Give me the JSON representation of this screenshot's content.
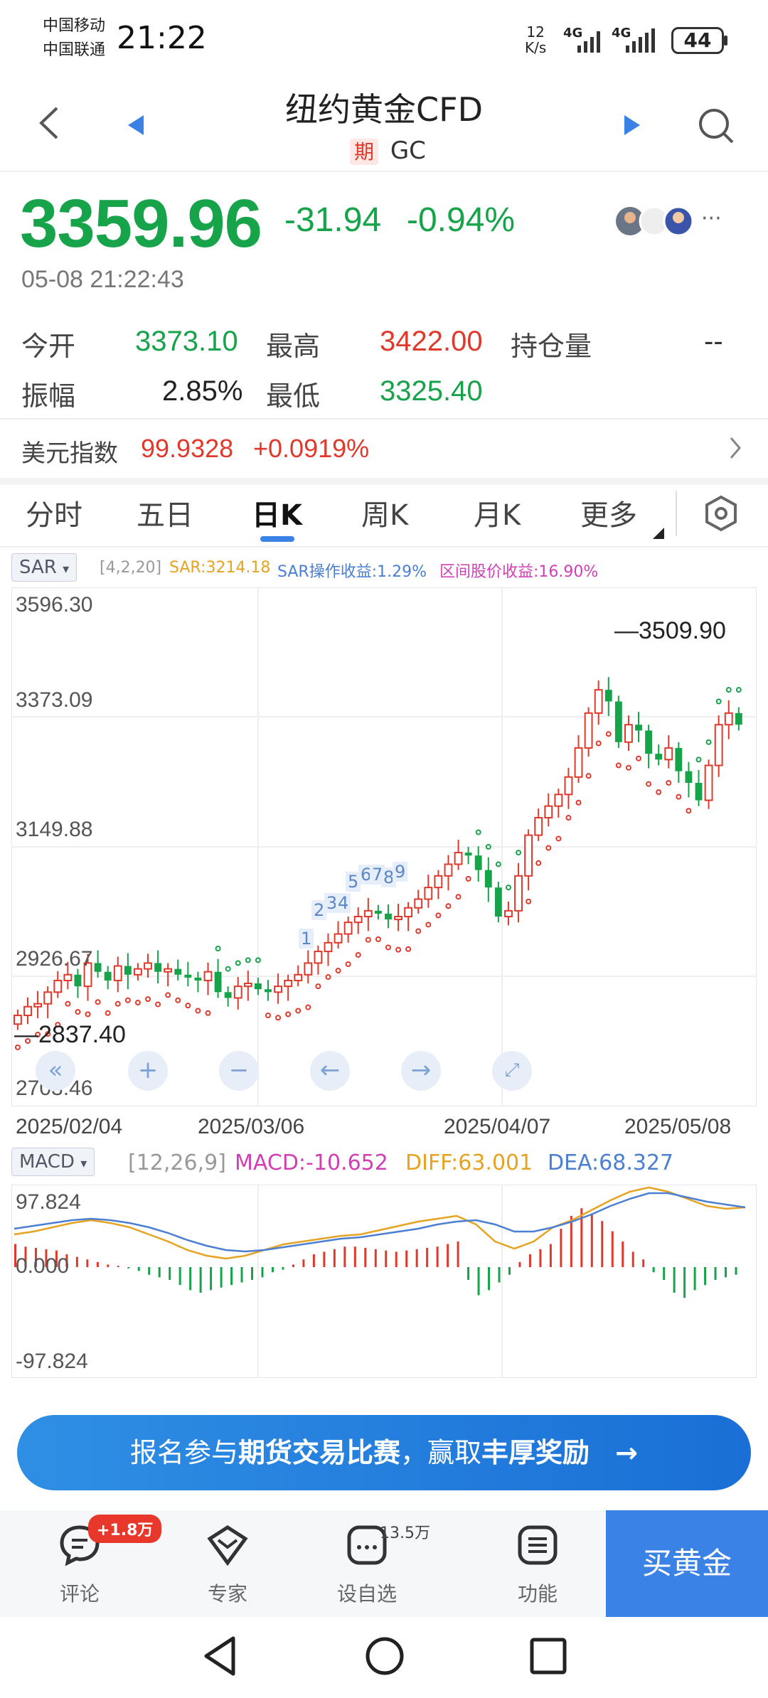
{
  "status": {
    "carrier1": "中国移动",
    "carrier2": "中国联通",
    "time": "21:22",
    "net_speed_value": "12",
    "net_speed_unit": "K/s",
    "sig1": "4G",
    "sig2": "4G",
    "battery": "44"
  },
  "header": {
    "title": "纽约黄金CFD",
    "badge": "期",
    "code": "GC"
  },
  "quote": {
    "price": "3359.96",
    "change": "-31.94",
    "change_pct": "-0.94%",
    "datetime": "05-08 21:22:43",
    "more": "···"
  },
  "stats": {
    "open_label": "今开",
    "open": "3373.10",
    "high_label": "最高",
    "high": "3422.00",
    "oi_label": "持仓量",
    "oi": "--",
    "amp_label": "振幅",
    "amp": "2.85%",
    "low_label": "最低",
    "low": "3325.40"
  },
  "usd": {
    "label": "美元指数",
    "value": "99.9328",
    "change": "+0.0919%"
  },
  "tabs": [
    "分时",
    "五日",
    "日K",
    "周K",
    "月K",
    "更多"
  ],
  "sar": {
    "name": "SAR",
    "params": "[4,2,20]",
    "sar_text": "SAR:3214.18",
    "op_text": "SAR操作收益:1.29%",
    "range_text": "区间股价收益:16.90%"
  },
  "kline": {
    "y_top": "3596.30",
    "y_2": "3373.09",
    "y_3": "3149.88",
    "y_4": "2926.67",
    "y_bottom": "2703.46",
    "max_label": "3509.90",
    "min_label": "2837.40",
    "dates": [
      "2025/02/04",
      "2025/03/06",
      "2025/04/07",
      "2025/05/08"
    ],
    "seq_labels": [
      "1",
      "2",
      "3",
      "4",
      "5",
      "6",
      "7",
      "8",
      "9"
    ]
  },
  "macd": {
    "name": "MACD",
    "params": "[12,26,9]",
    "macd_text": "MACD:-10.652",
    "diff_text": "DIFF:63.001",
    "dea_text": "DEA:68.327",
    "y_top": "97.824",
    "y_mid": "0.000",
    "y_bottom": "-97.824"
  },
  "banner": {
    "text_a": "报名参与",
    "text_b": "期货交易比赛",
    "text_c": "，赢取",
    "text_d": "丰厚奖励",
    "arrow": "→"
  },
  "bottom": {
    "comment": "评论",
    "comment_badge": "+1.8万",
    "expert": "专家",
    "watch": "设自选",
    "watch_count": "13.5万",
    "func": "功能",
    "buy": "买黄金"
  },
  "colors": {
    "up": "#e0392b",
    "down": "#17a34a",
    "accent": "#3b82e6",
    "sar_dot": "#17a34a"
  }
}
